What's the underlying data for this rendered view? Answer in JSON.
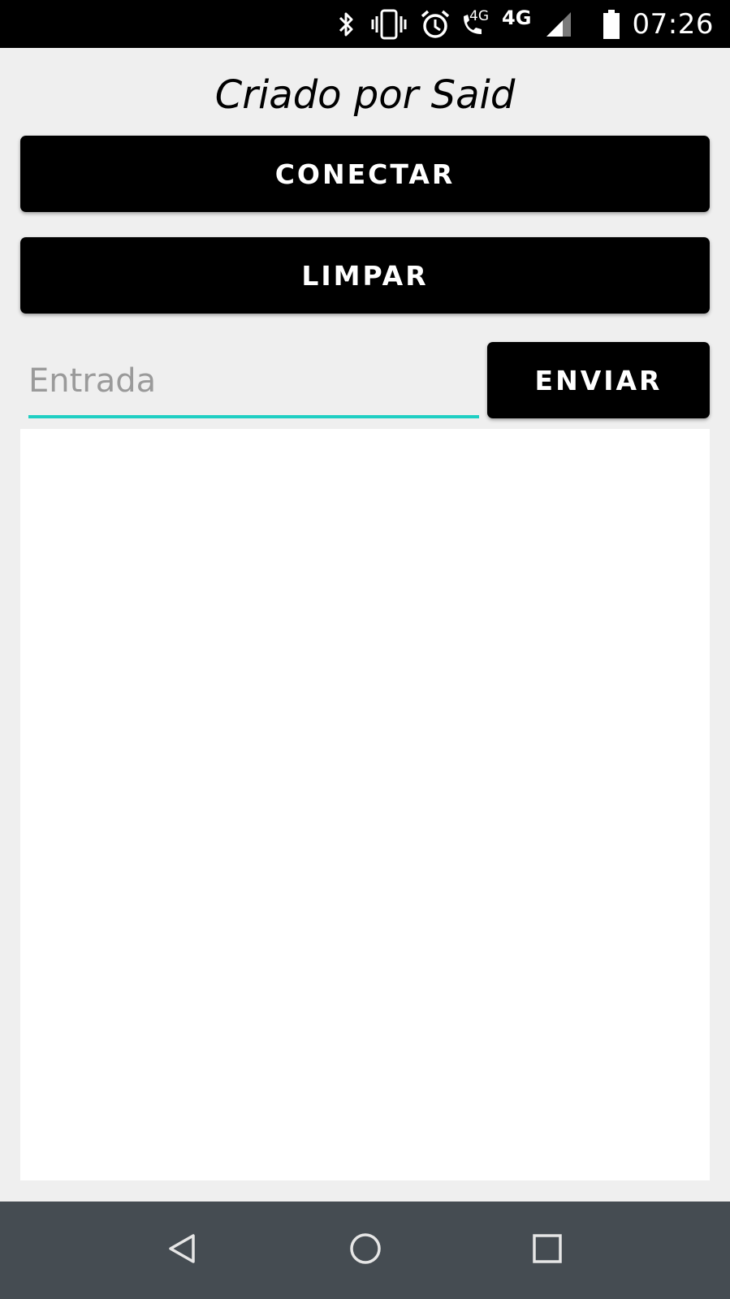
{
  "status_bar": {
    "time": "07:26",
    "network_call_label": "4G",
    "network_label": "4G",
    "icons": [
      "bluetooth-icon",
      "vibrate-icon",
      "alarm-icon",
      "wifi-call-icon",
      "signal-icon",
      "battery-icon"
    ]
  },
  "app": {
    "title": "Criado por Said",
    "connect_label": "CONECTAR",
    "clear_label": "LIMPAR",
    "input_placeholder": "Entrada",
    "input_value": "",
    "send_label": "ENVIAR",
    "output_text": ""
  },
  "nav_bar": {
    "icons": [
      "back-icon",
      "home-icon",
      "recents-icon"
    ]
  },
  "colors": {
    "accent": "#1fcfc3",
    "button_bg": "#000000",
    "page_bg": "#efefef",
    "nav_bg": "#454c52"
  }
}
